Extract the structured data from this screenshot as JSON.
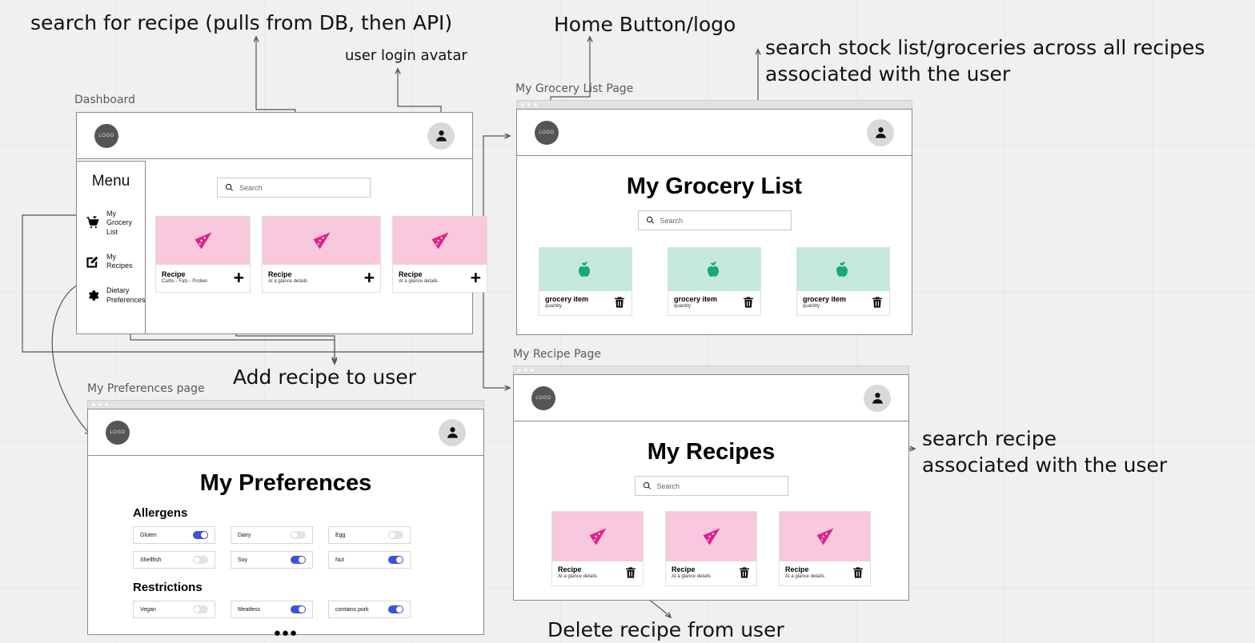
{
  "annotations": [
    {
      "id": "search-recipe",
      "text": "search for recipe (pulls from DB, then API)"
    },
    {
      "id": "home-logo",
      "text": "Home Button/logo"
    },
    {
      "id": "user-avatar",
      "text": "user login avatar"
    },
    {
      "id": "search-stock",
      "text": "search stock list/groceries across all recipes\nassociated with the user"
    },
    {
      "id": "add-recipe",
      "text": "Add recipe to user"
    },
    {
      "id": "search-user-recipe",
      "text": "search recipe\nassociated with the user"
    },
    {
      "id": "delete-recipe",
      "text": "Delete recipe from user"
    }
  ],
  "page_labels": {
    "dashboard": "Dashboard",
    "grocery": "My Grocery List Page",
    "preferences": "My Preferences page",
    "recipe": "My Recipe Page"
  },
  "common": {
    "logo_text": "LOGO",
    "search_placeholder": "Search",
    "search_icon": "search-icon",
    "avatar_icon": "user-avatar-icon",
    "trash_icon": "trash-icon",
    "plus_icon": "plus-icon"
  },
  "dashboard": {
    "menu_title": "Menu",
    "menu_items": [
      {
        "label": "My Grocery List",
        "icon": "shopping-cart-icon"
      },
      {
        "label": "My Recipes",
        "icon": "edit-pencil-icon"
      },
      {
        "label": "Dietary Preferences",
        "icon": "gear-icon"
      }
    ],
    "search_placeholder": "Search",
    "cards": [
      {
        "title": "Recipe",
        "subtitle": "Carbs - Fats - Protien",
        "action": "+",
        "icon": "pizza-slice-icon"
      },
      {
        "title": "Recipe",
        "subtitle": "At a glance details",
        "action": "+",
        "icon": "pizza-slice-icon"
      },
      {
        "title": "Recipe",
        "subtitle": "At a glance details",
        "action": "+",
        "icon": "pizza-slice-icon"
      }
    ]
  },
  "grocery_page": {
    "title": "My Grocery List",
    "search_placeholder": "Search",
    "cards": [
      {
        "title": "grocery item",
        "subtitle": "quantity",
        "icon": "apple-icon"
      },
      {
        "title": "grocery item",
        "subtitle": "quantity",
        "icon": "apple-icon"
      },
      {
        "title": "grocery item",
        "subtitle": "quantity",
        "icon": "apple-icon"
      }
    ]
  },
  "recipe_page": {
    "title": "My Recipes",
    "search_placeholder": "Search",
    "cards": [
      {
        "title": "Recipe",
        "subtitle": "At a glance details",
        "icon": "pizza-slice-icon"
      },
      {
        "title": "Recipe",
        "subtitle": "At a glance details",
        "icon": "pizza-slice-icon"
      },
      {
        "title": "Recipe",
        "subtitle": "At a glance details",
        "icon": "pizza-slice-icon"
      }
    ]
  },
  "preferences_page": {
    "title": "My Preferences",
    "sections": [
      {
        "heading": "Allergens",
        "columns": [
          [
            {
              "label": "Gluten",
              "on": true
            },
            {
              "label": "Shellfish",
              "on": false
            }
          ],
          [
            {
              "label": "Dairy",
              "on": false
            },
            {
              "label": "Soy",
              "on": true
            }
          ],
          [
            {
              "label": "Egg",
              "on": false
            },
            {
              "label": "Nut",
              "on": true
            }
          ]
        ]
      },
      {
        "heading": "Restrictions",
        "columns": [
          [
            {
              "label": "Vegan",
              "on": false
            }
          ],
          [
            {
              "label": "Meatless",
              "on": true
            }
          ],
          [
            {
              "label": "contains pork",
              "on": true
            }
          ]
        ]
      }
    ],
    "more_dots": "●●●"
  },
  "colors": {
    "canvas": "#f0f0f0",
    "recipe_card_bg": "#f8c8dc",
    "recipe_icon": "#e0218a",
    "grocery_card_bg": "#c5e8dc",
    "grocery_icon": "#17a87f",
    "toggle_on": "#3f51d8",
    "toggle_off": "#e3e3e3"
  }
}
